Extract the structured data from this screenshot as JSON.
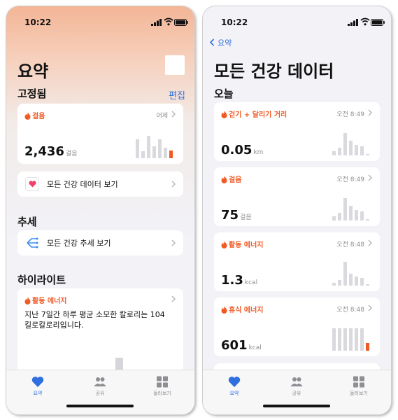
{
  "status_bar": {
    "time": "10:22"
  },
  "left": {
    "title": "요약",
    "pinned": {
      "heading": "고정됨",
      "edit": "편집"
    },
    "steps_card": {
      "title": "걸음",
      "time": "어제",
      "value": "2,436",
      "unit": "걸음",
      "bars": [
        0.7,
        0.25,
        0.85,
        0.45,
        0.7,
        0.4,
        0.3
      ],
      "highlight_index": 6
    },
    "all_data_row": {
      "label": "모든 건강 데이터 보기"
    },
    "trends": {
      "heading": "추세",
      "row_label": "모든 건강 추세 보기"
    },
    "highlights": {
      "heading": "하이라이트",
      "card_title": "활동 에너지",
      "text": "지난 7일간 하루 평균 소모한 칼로리는 104킬로칼로리입니다.",
      "bars": [
        0.4,
        0.65
      ]
    },
    "tabs": [
      {
        "label": "요약",
        "icon": "heart-icon"
      },
      {
        "label": "공유",
        "icon": "people-icon"
      },
      {
        "label": "둘러보기",
        "icon": "grid-icon"
      }
    ]
  },
  "right": {
    "back": "요약",
    "title": "모든 건강 데이터",
    "section": "오늘",
    "cards": [
      {
        "title": "걷기 + 달리기 거리",
        "time": "오전 8:49",
        "value": "0.05",
        "unit": "km",
        "bars": [
          0.15,
          0.3,
          0.85,
          0.55,
          0.4,
          0.35,
          0.05
        ],
        "highlight_index": -1
      },
      {
        "title": "걸음",
        "time": "오전 8:49",
        "value": "75",
        "unit": "걸음",
        "bars": [
          0.15,
          0.3,
          0.85,
          0.55,
          0.4,
          0.35,
          0.05
        ],
        "highlight_index": -1
      },
      {
        "title": "활동 에너지",
        "time": "오전 8:48",
        "value": "1.3",
        "unit": "kcal",
        "bars": [
          0.1,
          0.2,
          0.9,
          0.45,
          0.35,
          0.3,
          0.05
        ],
        "highlight_index": -1
      },
      {
        "title": "휴식 에너지",
        "time": "오전 8:48",
        "value": "601",
        "unit": "kcal",
        "bars": [
          0.85,
          0.85,
          0.85,
          0.85,
          0.85,
          0.85,
          0.3
        ],
        "highlight_index": 6
      }
    ],
    "tabs": [
      {
        "label": "요약",
        "icon": "heart-icon"
      },
      {
        "label": "공유",
        "icon": "people-icon"
      },
      {
        "label": "둘러보기",
        "icon": "grid-icon"
      }
    ]
  },
  "colors": {
    "accent": "#2f6fde",
    "activity": "#f15a24",
    "bar_grey": "#d9d9de"
  }
}
